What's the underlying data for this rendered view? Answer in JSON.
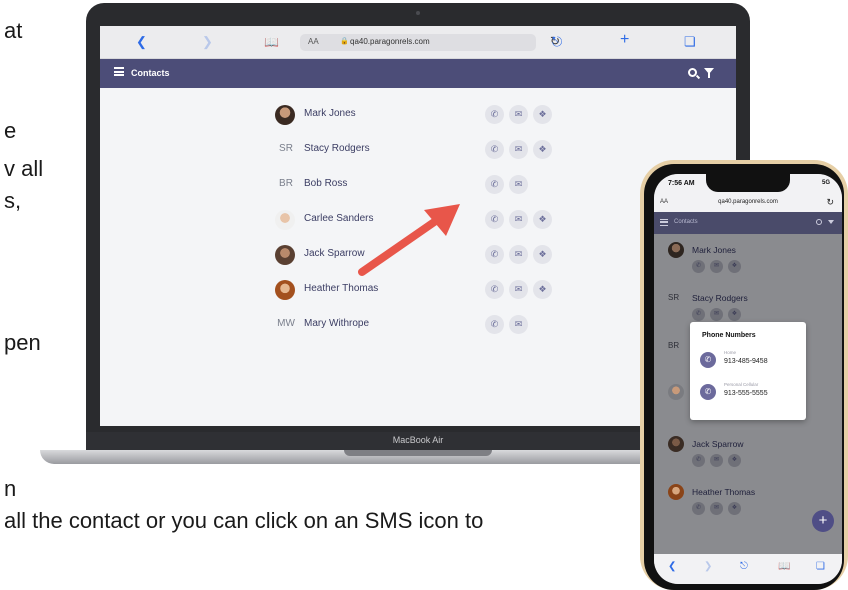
{
  "slide_fragments": {
    "line1": "at",
    "line2": "e",
    "line3": "v all",
    "line4": "s,",
    "line5": "pen",
    "line6": "n",
    "line7": "all the contact or you can click on an SMS icon to"
  },
  "laptop": {
    "brand_label": "MacBook Air",
    "browser": {
      "aa_label": "AA",
      "url": "qa40.paragonrels.com"
    },
    "app": {
      "header_title": "Contacts"
    },
    "contacts": [
      {
        "name": "Mark Jones",
        "initials": "",
        "actions": 3
      },
      {
        "name": "Stacy Rodgers",
        "initials": "SR",
        "actions": 3
      },
      {
        "name": "Bob Ross",
        "initials": "BR",
        "actions": 2
      },
      {
        "name": "Carlee Sanders",
        "initials": "",
        "actions": 3
      },
      {
        "name": "Jack Sparrow",
        "initials": "",
        "actions": 3
      },
      {
        "name": "Heather Thomas",
        "initials": "",
        "actions": 3
      },
      {
        "name": "Mary Withrope",
        "initials": "MW",
        "actions": 2
      }
    ]
  },
  "phone": {
    "time": "7:56 AM",
    "signal": "5G",
    "aa_label": "AA",
    "url": "qa40.paragonrels.com",
    "header_title": "Contacts",
    "contacts": [
      {
        "name": "Mark Jones",
        "initials": ""
      },
      {
        "name": "Stacy Rodgers",
        "initials": "SR"
      },
      {
        "name": "",
        "initials": "BR"
      },
      {
        "name": "",
        "initials": ""
      },
      {
        "name": "Jack Sparrow",
        "initials": ""
      },
      {
        "name": "Heather Thomas",
        "initials": ""
      }
    ],
    "popup": {
      "title": "Phone Numbers",
      "numbers": [
        {
          "label": "Home",
          "number": "913-485-9458"
        },
        {
          "label": "Personal Cellular",
          "number": "913-555-5555"
        }
      ]
    },
    "fab_label": "+"
  },
  "colors": {
    "header": "#4c4d78",
    "accent_arrow": "#e8564a",
    "link_blue": "#2e6be6"
  }
}
